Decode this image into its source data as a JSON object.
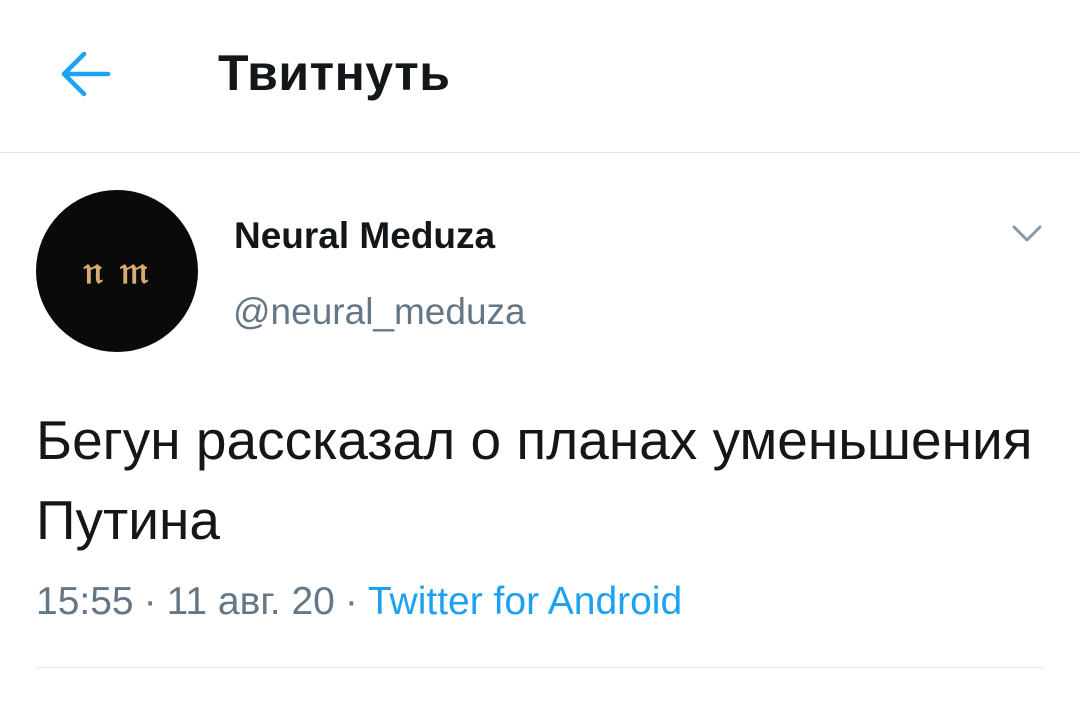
{
  "header": {
    "title": "Твитнуть",
    "back_icon": "arrow-left-icon"
  },
  "tweet": {
    "avatar_text": "𝔫 𝔪",
    "display_name": "Neural Meduza",
    "handle": "@neural_meduza",
    "menu_icon": "chevron-down-icon",
    "text": "Бегун рассказал о планах уменьшения Путина",
    "time": "15:55",
    "date": "11 авг. 20",
    "separator": "·",
    "source": "Twitter for Android"
  },
  "colors": {
    "accent": "#1da1f2",
    "text_primary": "#14171a",
    "text_secondary": "#657786",
    "divider": "#e1e8ed",
    "avatar_bg": "#0a0a0a",
    "avatar_logo": "#d7ab72"
  }
}
